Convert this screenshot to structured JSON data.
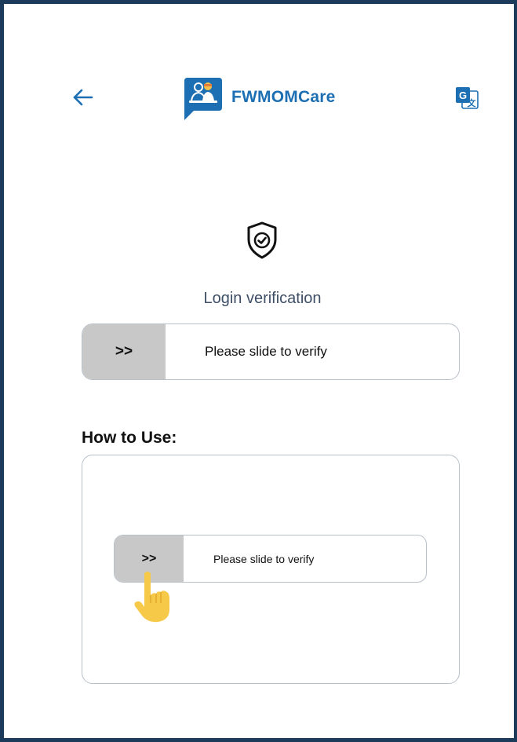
{
  "header": {
    "app_name": "FWMOMCare",
    "back_icon": "back-arrow-icon",
    "translate_icon": "google-translate-icon",
    "logo_icon": "fwmomcare-logo-icon"
  },
  "verification": {
    "shield_icon": "shield-check-icon",
    "title": "Login verification",
    "slider": {
      "handle_label": ">>",
      "text": "Please slide to verify"
    }
  },
  "how_to_use": {
    "title": "How to Use:",
    "demo_slider": {
      "handle_label": ">>",
      "text": "Please slide to verify"
    },
    "hand_icon": "pointing-hand-icon"
  },
  "colors": {
    "brand_blue": "#1d6fb3",
    "frame": "#1c3b5a",
    "handle_gray": "#c8c8c8",
    "title_gray": "#3e4f66",
    "hand_yellow": "#f7c948"
  }
}
